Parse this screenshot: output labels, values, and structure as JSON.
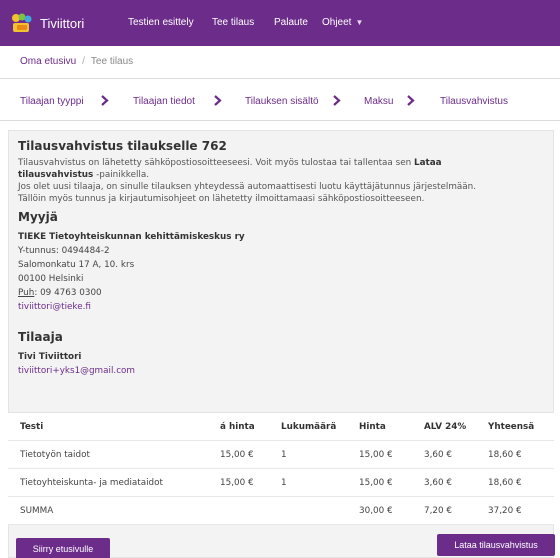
{
  "colors": {
    "brand": "#6b2c8a",
    "panel_bg": "#f3f3f3"
  },
  "navbar": {
    "brand": "Tiviittori",
    "links": [
      "Testien esittely",
      "Tee tilaus",
      "Palaute",
      "Ohjeet"
    ]
  },
  "breadcrumb": {
    "home": "Oma etusivu",
    "separator": "/",
    "current": "Tee tilaus"
  },
  "steps": [
    "Tilaajan tyyppi",
    "Tilaajan tiedot",
    "Tilauksen sisältö",
    "Maksu",
    "Tilausvahvistus"
  ],
  "confirmation": {
    "title": "Tilausvahvistus tilaukselle 762",
    "p1_a": "Tilausvahvistus on lähetetty sähköpostiosoitteeseesi. Voit myös tulostaa tai tallentaa sen ",
    "p1_b": "Lataa",
    "p2_a": "tilausvahvistus",
    "p2_b": " -painikkella.",
    "p3": "Jos olet uusi tilaaja, on sinulle tilauksen yhteydessä automaattisesti luotu käyttäjätunnus järjestelmään.",
    "p4": "Tällöin myös tunnus ja kirjautumisohjeet on lähetetty ilmoittamaasi sähköpostiosoitteeseen."
  },
  "seller": {
    "heading": "Myyjä",
    "name": "TIEKE Tietoyhteiskunnan kehittämiskeskus ry",
    "ytunnus": "Y-tunnus: 0494484-2",
    "street": "Salomonkatu 17 A, 10. krs",
    "city": "00100 Helsinki",
    "phone_label": "Puh",
    "phone": ": 09 4763 0300",
    "email": "tiviittori@tieke.fi"
  },
  "buyer": {
    "heading": "Tilaaja",
    "name": "Tivi Tiviittori",
    "email": "tiviittori+yks1@gmail.com"
  },
  "table": {
    "headers": [
      "Testi",
      "á hinta",
      "Lukumäärä",
      "Hinta",
      "ALV 24%",
      "Yhteensä"
    ],
    "rows": [
      [
        "Tietotyön taidot",
        "15,00 €",
        "1",
        "15,00 €",
        "3,60 €",
        "18,60 €"
      ],
      [
        "Tietoyhteiskunta- ja mediataidot",
        "15,00 €",
        "1",
        "15,00 €",
        "3,60 €",
        "18,60 €"
      ],
      [
        "SUMMA",
        "",
        "",
        "30,00 €",
        "7,20 €",
        "37,20 €"
      ]
    ]
  },
  "buttons": {
    "home": "Siirry etusivulle",
    "download": "Lataa tilausvahvistus"
  }
}
